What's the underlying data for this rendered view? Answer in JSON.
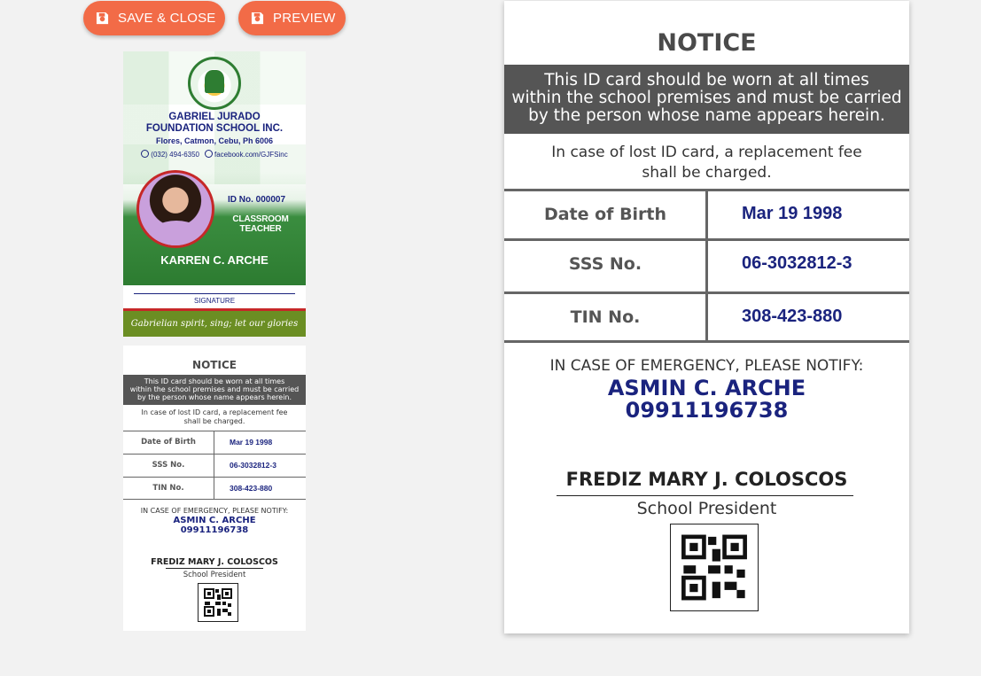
{
  "toolbar": {
    "save_label": "SAVE & CLOSE",
    "preview_label": "PREVIEW"
  },
  "front_card": {
    "school_line1": "GABRIEL JURADO",
    "school_line2": "FOUNDATION SCHOOL INC.",
    "address": "Flores, Catmon, Cebu, Ph 6006",
    "phone": "(032) 494-6350",
    "facebook": "facebook.com/GJFSinc",
    "id_number": "ID No. 000007",
    "role": "CLASSROOM TEACHER",
    "name": "KARREN C. ARCHE",
    "signature_label": "SIGNATURE",
    "motto": "Gabrielian spirit, sing; let our glories ring."
  },
  "back_card": {
    "notice_title": "NOTICE",
    "notice_line1": "This ID card should be worn at all times",
    "notice_line2": "within the school premises and must be carried",
    "notice_line3": "by the person whose name appears herein.",
    "lost_line1": "In case of lost ID card, a replacement fee",
    "lost_line2": "shall be charged.",
    "rows": [
      {
        "label": "Date of Birth",
        "value": "Mar 19 1998"
      },
      {
        "label": "SSS No.",
        "value": "06-3032812-3"
      },
      {
        "label": "TIN No.",
        "value": "308-423-880"
      }
    ],
    "emergency_label": "IN CASE OF EMERGENCY, PLEASE NOTIFY:",
    "emergency_name": "ASMIN C. ARCHE",
    "emergency_phone": "09911196738",
    "president_name": "FREDIZ MARY J. COLOSCOS",
    "president_title": "School President"
  },
  "colors": {
    "button": "#f26b47",
    "navy": "#1a237e",
    "green": "#2e7d32",
    "notice_band": "#555555"
  },
  "icons": {
    "save": "floppy-disk-icon",
    "preview": "floppy-disk-icon"
  }
}
